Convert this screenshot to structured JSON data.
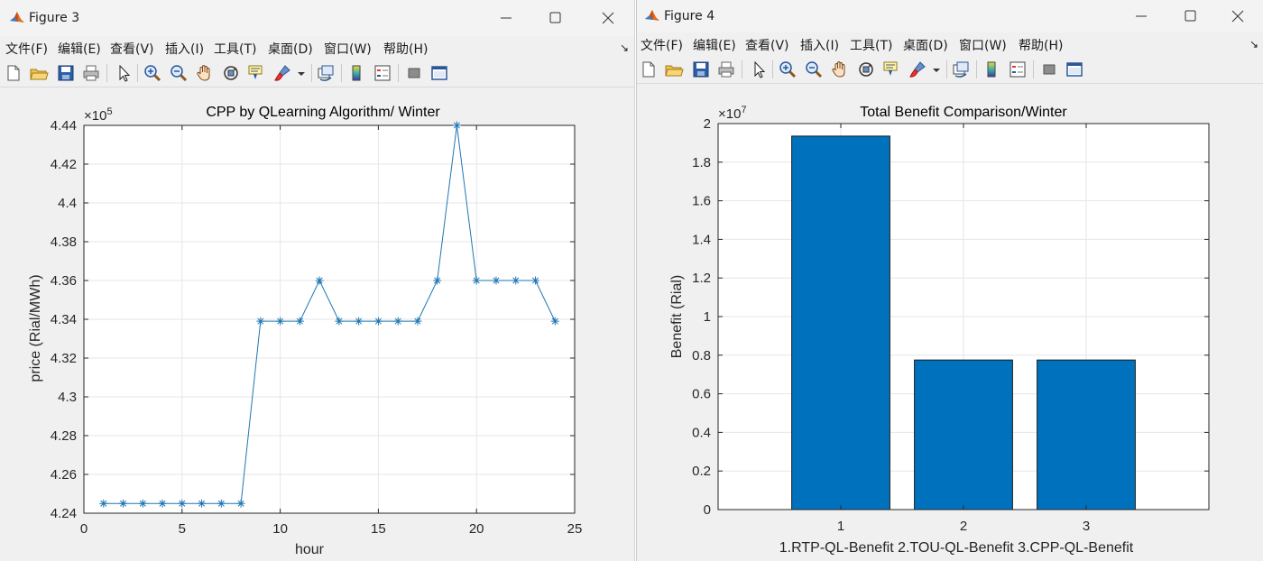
{
  "menu_items": [
    "文件(F)",
    "编辑(E)",
    "查看(V)",
    "插入(I)",
    "工具(T)",
    "桌面(D)",
    "窗口(W)",
    "帮助(H)"
  ],
  "toolbar_icons": [
    "new-figure-icon",
    "open-file-icon",
    "save-icon",
    "print-icon",
    "select-arrow-icon",
    "zoom-in-icon",
    "zoom-out-icon",
    "pan-hand-icon",
    "rotate-3d-icon",
    "data-cursor-icon",
    "brush-icon",
    "brush-dropdown-icon",
    "link-plot-icon",
    "colorbar-icon",
    "legend-icon",
    "hide-plot-tools-icon",
    "show-plot-tools-icon"
  ],
  "windows": {
    "fig3": {
      "title": "Figure 3"
    },
    "fig4": {
      "title": "Figure 4"
    }
  },
  "colors": {
    "series": "#1f77b4",
    "bar": "#0072bd",
    "grid": "#e6e6e6"
  },
  "chart_data": [
    {
      "type": "line",
      "title": "CPP by QLearning Algorithm/ Winter",
      "xlabel": "hour",
      "ylabel": "price (Rial/MWh)",
      "exponent_label": "×10",
      "exponent_power": "5",
      "xlim": [
        0,
        25
      ],
      "ylim": [
        4.24,
        4.44
      ],
      "xticks": [
        0,
        5,
        10,
        15,
        20,
        25
      ],
      "yticks": [
        4.24,
        4.26,
        4.28,
        4.3,
        4.32,
        4.34,
        4.36,
        4.38,
        4.4,
        4.42,
        4.44
      ],
      "ytick_labels": [
        "4.24",
        "4.26",
        "4.28",
        "4.3",
        "4.32",
        "4.34",
        "4.36",
        "4.38",
        "4.4",
        "4.42",
        "4.44"
      ],
      "grid": true,
      "marker": "asterisk",
      "x": [
        1,
        2,
        3,
        4,
        5,
        6,
        7,
        8,
        9,
        10,
        11,
        12,
        13,
        14,
        15,
        16,
        17,
        18,
        19,
        20,
        21,
        22,
        23,
        24
      ],
      "y": [
        4.245,
        4.245,
        4.245,
        4.245,
        4.245,
        4.245,
        4.245,
        4.245,
        4.339,
        4.339,
        4.339,
        4.36,
        4.339,
        4.339,
        4.339,
        4.339,
        4.339,
        4.36,
        4.44,
        4.36,
        4.36,
        4.36,
        4.36,
        4.339
      ]
    },
    {
      "type": "bar",
      "title": "Total Benefit Comparison/Winter",
      "xlabel": "1.RTP-QL-Benefit 2.TOU-QL-Benefit 3.CPP-QL-Benefit",
      "ylabel": "Benefit (Rial)",
      "exponent_label": "×10",
      "exponent_power": "7",
      "categories": [
        "1",
        "2",
        "3"
      ],
      "values": [
        1.935,
        0.775,
        0.775
      ],
      "xlim": [
        0,
        4
      ],
      "ylim": [
        0,
        2
      ],
      "yticks": [
        0,
        0.2,
        0.4,
        0.6,
        0.8,
        1,
        1.2,
        1.4,
        1.6,
        1.8,
        2
      ],
      "ytick_labels": [
        "0",
        "0.2",
        "0.4",
        "0.6",
        "0.8",
        "1",
        "1.2",
        "1.4",
        "1.6",
        "1.8",
        "2"
      ],
      "grid": true
    }
  ]
}
